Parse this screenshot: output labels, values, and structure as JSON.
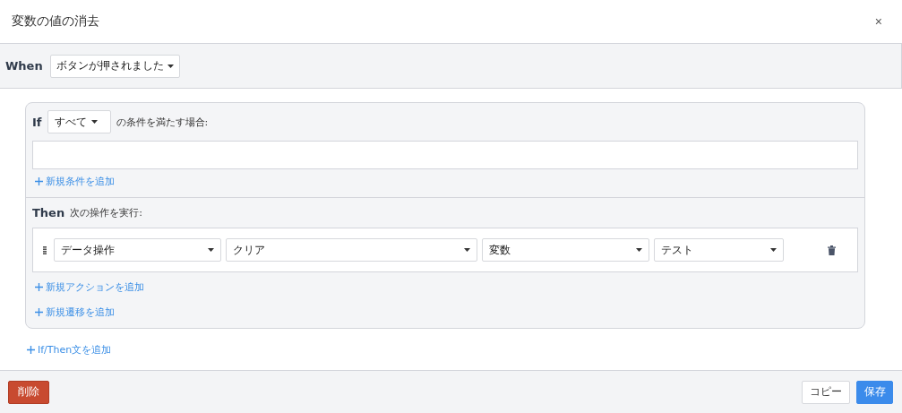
{
  "dialog": {
    "title": "変数の値の消去",
    "close": "×"
  },
  "when": {
    "label": "When",
    "trigger": "ボタンが押されました"
  },
  "rule": {
    "if_label": "If",
    "match": "すべて",
    "match_suffix": "の条件を満たす場合:",
    "add_condition": "新規条件を追加",
    "then_label": "Then",
    "then_suffix": "次の操作を実行:",
    "actions": [
      {
        "selects": [
          "データ操作",
          "クリア",
          "変数",
          "テスト"
        ]
      }
    ],
    "add_action": "新規アクションを追加",
    "add_transition": "新規遷移を追加"
  },
  "add_rule": "If/Then文を追加",
  "footer": {
    "delete": "削除",
    "copy": "コピー",
    "save": "保存"
  }
}
